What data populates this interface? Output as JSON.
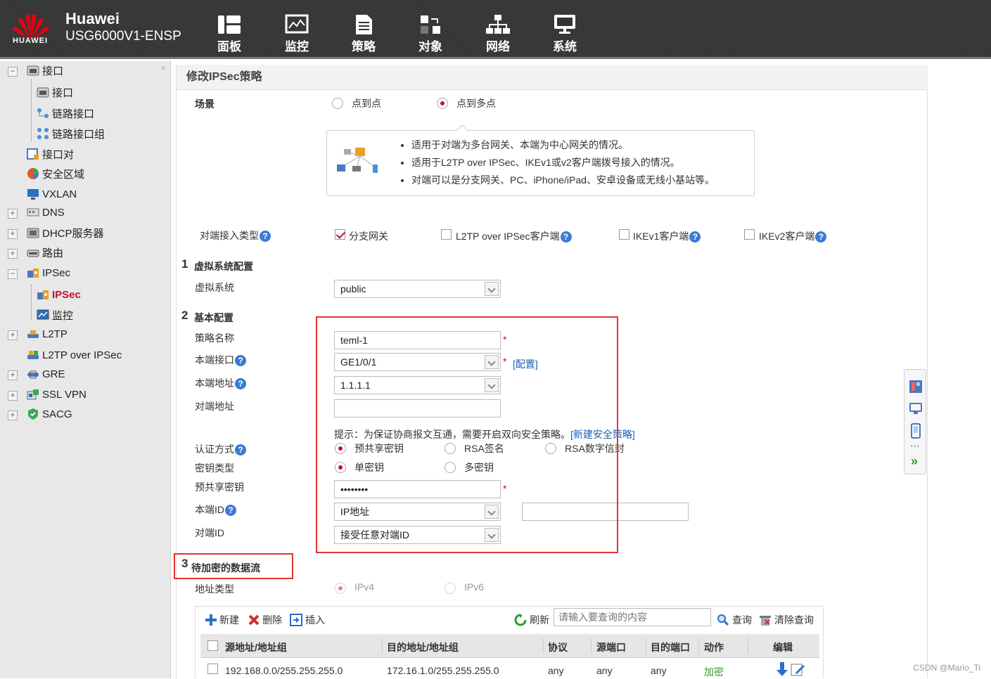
{
  "header": {
    "brand": "Huawei",
    "model": "USG6000V1-ENSP",
    "logo_text": "HUAWEI",
    "nav": [
      {
        "label": "面板",
        "icon": "dashboard-icon"
      },
      {
        "label": "监控",
        "icon": "monitor-icon"
      },
      {
        "label": "策略",
        "icon": "policy-icon"
      },
      {
        "label": "对象",
        "icon": "object-icon"
      },
      {
        "label": "网络",
        "icon": "network-icon"
      },
      {
        "label": "系统",
        "icon": "system-icon"
      }
    ]
  },
  "sidebar": {
    "items": [
      {
        "label": "接口"
      },
      {
        "label": "接口"
      },
      {
        "label": "链路接口"
      },
      {
        "label": "链路接口组"
      },
      {
        "label": "接口对"
      },
      {
        "label": "安全区域"
      },
      {
        "label": "VXLAN"
      },
      {
        "label": "DNS"
      },
      {
        "label": "DHCP服务器"
      },
      {
        "label": "路由"
      },
      {
        "label": "IPSec"
      },
      {
        "label": "IPSec"
      },
      {
        "label": "监控"
      },
      {
        "label": "L2TP"
      },
      {
        "label": "L2TP over IPSec"
      },
      {
        "label": "GRE"
      },
      {
        "label": "SSL VPN"
      },
      {
        "label": "SACG"
      }
    ]
  },
  "form": {
    "title": "修改IPSec策略",
    "scene_label": "场景",
    "scene_p2p": "点到点",
    "scene_p2mp": "点到多点",
    "tips": [
      "适用于对端为多台网关、本端为中心网关的情况。",
      "适用于L2TP over IPSec、IKEv1或v2客户端拨号接入的情况。",
      "对端可以是分支网关、PC、iPhone/iPad、安卓设备或无线小基站等。"
    ],
    "peer_type_label": "对端接入类型",
    "peer_types": [
      "分支网关",
      "L2TP over IPSec客户端",
      "IKEv1客户端",
      "IKEv2客户端"
    ],
    "sec1_num": "1",
    "sec1_title": "虚拟系统配置",
    "vsys_label": "虚拟系统",
    "vsys_value": "public",
    "sec2_num": "2",
    "sec2_title": "基本配置",
    "policy_name_label": "策略名称",
    "policy_name_value": "teml-1",
    "local_if_label": "本端接口",
    "local_if_value": "GE1/0/1",
    "config_link": "[配置]",
    "local_addr_label": "本端地址",
    "local_addr_value": "1.1.1.1",
    "peer_addr_label": "对端地址",
    "peer_addr_value": "",
    "hint_text": "提示：为保证协商报文互通，需要开启双向安全策略。",
    "hint_link": "[新建安全策略]",
    "auth_label": "认证方式",
    "auth_opts": [
      "预共享密钥",
      "RSA签名",
      "RSA数字信封"
    ],
    "key_type_label": "密钥类型",
    "key_opts": [
      "单密钥",
      "多密钥"
    ],
    "psk_label": "预共享密钥",
    "psk_value": "••••••••",
    "local_id_label": "本端ID",
    "local_id_value": "IP地址",
    "peer_id_label": "对端ID",
    "peer_id_value": "接受任意对端ID",
    "required_mark": "*",
    "sec3_num": "3",
    "sec3_title": "待加密的数据流",
    "addr_type_label": "地址类型",
    "addr_opts": [
      "IPv4",
      "IPv6"
    ]
  },
  "toolbar": {
    "new": "新建",
    "delete": "删除",
    "insert": "插入",
    "refresh": "刷新",
    "search_placeholder": "请输入要查询的内容",
    "query": "查询",
    "clear_query": "清除查询"
  },
  "table": {
    "headers": [
      "源地址/地址组",
      "目的地址/地址组",
      "协议",
      "源端口",
      "目的端口",
      "动作",
      "编辑"
    ],
    "rows": [
      {
        "src": "192.168.0.0/255.255.255.0",
        "dst": "172.16.1.0/255.255.255.0",
        "proto": "any",
        "sport": "any",
        "dport": "any",
        "action": "加密"
      }
    ]
  },
  "watermark": "CSDN @Mario_Ti",
  "colors": {
    "accent_red": "#c8102e",
    "highlight_box": "#e03535",
    "link": "#1a5fb4",
    "action_green": "#2a9d2a"
  }
}
